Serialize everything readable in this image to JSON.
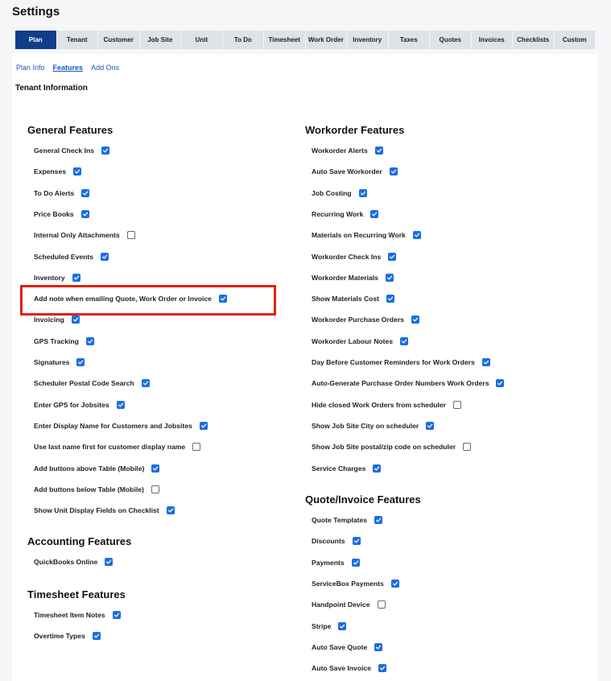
{
  "page_title": "Settings",
  "tabs": [
    {
      "label": "Plan",
      "active": true
    },
    {
      "label": "Tenant"
    },
    {
      "label": "Customer"
    },
    {
      "label": "Job Site"
    },
    {
      "label": "Unit"
    },
    {
      "label": "To Do"
    },
    {
      "label": "Timesheet"
    },
    {
      "label": "Work Order"
    },
    {
      "label": "Inventory"
    },
    {
      "label": "Taxes"
    },
    {
      "label": "Quotes"
    },
    {
      "label": "Invoices"
    },
    {
      "label": "Checklists"
    },
    {
      "label": "Custom"
    }
  ],
  "subnav": [
    {
      "label": "Plan Info"
    },
    {
      "label": "Features",
      "active": true
    },
    {
      "label": "Add Ons"
    }
  ],
  "tenant_info": "Tenant Information",
  "colors": {
    "accent": "#1a6fe0",
    "active_tab": "#113e8a",
    "highlight": "#e0210f"
  },
  "sections": [
    {
      "title": "General Features",
      "features": [
        {
          "label": "General Check Ins",
          "checked": true
        },
        {
          "label": "Expenses",
          "checked": true
        },
        {
          "label": "To Do Alerts",
          "checked": true
        },
        {
          "label": "Price Books",
          "checked": true
        },
        {
          "label": "Internal Only Attachments",
          "checked": false
        },
        {
          "label": "Scheduled Events",
          "checked": true
        },
        {
          "label": "Inventory",
          "checked": true
        },
        {
          "label": "Add note when emailing Quote, Work Order or Invoice",
          "checked": true
        },
        {
          "label": "Invoicing",
          "checked": true
        },
        {
          "label": "GPS Tracking",
          "checked": true
        },
        {
          "label": "Signatures",
          "checked": true
        },
        {
          "label": "Scheduler Postal Code Search",
          "checked": true
        },
        {
          "label": "Enter GPS for Jobsites",
          "checked": true
        },
        {
          "label": "Enter Display Name for Customers and Jobsites",
          "checked": true
        },
        {
          "label": "Use last name first for customer display name",
          "checked": false
        },
        {
          "label": "Add buttons above Table (Mobile)",
          "checked": true
        },
        {
          "label": "Add buttons below Table (Mobile)",
          "checked": false
        },
        {
          "label": "Show Unit Display Fields on Checklist",
          "checked": true
        }
      ]
    },
    {
      "title": "Accounting Features",
      "features": [
        {
          "label": "QuickBooks Online",
          "checked": true
        }
      ]
    },
    {
      "title": "Timesheet Features",
      "features": [
        {
          "label": "Timesheet Item Notes",
          "checked": true
        },
        {
          "label": "Overtime Types",
          "checked": true
        }
      ]
    },
    {
      "title": "Workorder Features",
      "features": [
        {
          "label": "Workorder Alerts",
          "checked": true
        },
        {
          "label": "Auto Save Workorder",
          "checked": true
        },
        {
          "label": "Job Costing",
          "checked": true
        },
        {
          "label": "Recurring Work",
          "checked": true
        },
        {
          "label": "Materials on Recurring Work",
          "checked": true
        },
        {
          "label": "Workorder Check Ins",
          "checked": true
        },
        {
          "label": "Workorder Materials",
          "checked": true
        },
        {
          "label": "Show Materials Cost",
          "checked": true
        },
        {
          "label": "Workorder Purchase Orders",
          "checked": true
        },
        {
          "label": "Workorder Labour Notes",
          "checked": true
        },
        {
          "label": "Day Before Customer Reminders for Work Orders",
          "checked": true
        },
        {
          "label": "Auto-Generate Purchase Order Numbers Work Orders",
          "checked": true
        },
        {
          "label": "Hide closed Work Orders from scheduler",
          "checked": false
        },
        {
          "label": "Show Job Site City on scheduler",
          "checked": true
        },
        {
          "label": "Show Job Site postal/zip code on scheduler",
          "checked": false
        },
        {
          "label": "Service Charges",
          "checked": true
        }
      ]
    },
    {
      "title": "Quote/Invoice Features",
      "features": [
        {
          "label": "Quote Templates",
          "checked": true
        },
        {
          "label": "Discounts",
          "checked": true
        },
        {
          "label": "Payments",
          "checked": true
        },
        {
          "label": "ServiceBox Payments",
          "checked": true
        },
        {
          "label": "Handpoint Device",
          "checked": false
        },
        {
          "label": "Stripe",
          "checked": true
        },
        {
          "label": "Auto Save Quote",
          "checked": true
        },
        {
          "label": "Auto Save Invoice",
          "checked": true
        }
      ]
    }
  ]
}
